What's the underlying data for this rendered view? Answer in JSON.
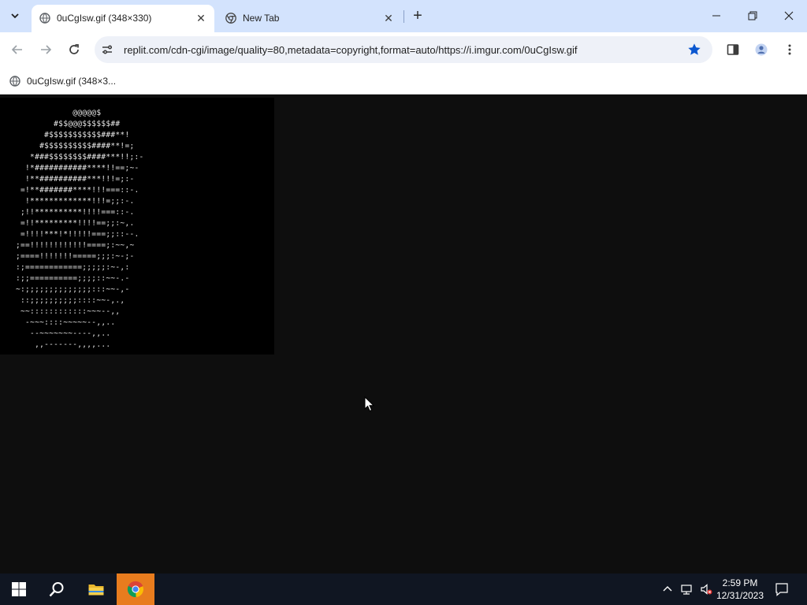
{
  "browser": {
    "tabs": [
      {
        "title": "0uCgIsw.gif (348×330)",
        "active": true
      },
      {
        "title": "New Tab",
        "active": false
      }
    ],
    "url": "replit.com/cdn-cgi/image/quality=80,metadata=copyright,format=auto/https://i.imgur.com/0uCgIsw.gif",
    "bookmarked": true,
    "bookmarks": [
      {
        "label": "0uCgIsw.gif (348×3..."
      }
    ],
    "accent": "#0b57d0"
  },
  "page": {
    "ascii_art": "            @@@@@$\n        #$$@@@$$$$$$##\n      #$$$$$$$$$$$###**!\n     #$$$$$$$$$$####**!=;\n   *###$$$$$$$$####***!!;:-\n  !*###########****!!==;~-\n  !**##########***!!!=;:-\n =!**#######****!!!===::-.\n  !*************!!!=;;:-.\n ;!!**********!!!!===::-.\n =!!*********!!!!==;;:~,.\n =!!!!***!*!!!!!===;;::--.\n;==!!!!!!!!!!!!====;:~~,~\n;====!!!!!!!=====;;;:~-;-\n:;============;;;;;:~-,:\n:;;==========;;;;::~~-.-\n~:;;;;;;;;;;;;;;:::~~-,-\n ::;;;;;;;;;;::::~~-,.,\n ~~::::::::::::~~~--,,\n  -~~~::::~~~~~--,,..\n   --~~~~~~~----,,..\n    ,,-------,,,,..."
  },
  "taskbar": {
    "time": "2:59 PM",
    "date": "12/31/2023"
  }
}
